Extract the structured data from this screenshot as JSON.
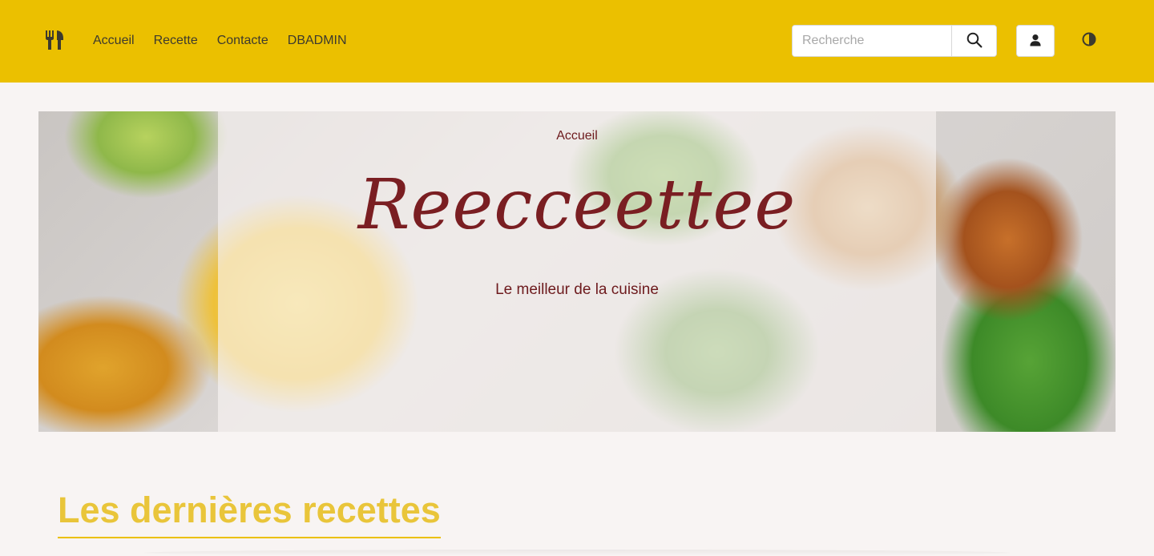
{
  "navbar": {
    "brand_icon": "fork-knife-icon",
    "links": [
      {
        "label": "Accueil"
      },
      {
        "label": "Recette"
      },
      {
        "label": "Contacte"
      },
      {
        "label": "DBADMIN"
      }
    ],
    "search": {
      "placeholder": "Recherche",
      "value": ""
    },
    "search_icon": "search-icon",
    "user_icon": "user-icon",
    "theme_icon": "half-circle-icon",
    "colors": {
      "bar": "#ebc000",
      "text": "#3d3a2e"
    }
  },
  "hero": {
    "breadcrumb": "Accueil",
    "title": "Reecceettee",
    "subtitle": "Le meilleur de la cuisine",
    "colors": {
      "text": "#7a1e22"
    }
  },
  "section": {
    "title": "Les dernières recettes",
    "colors": {
      "title": "#e9c53a",
      "underline": "#ebc000"
    }
  }
}
